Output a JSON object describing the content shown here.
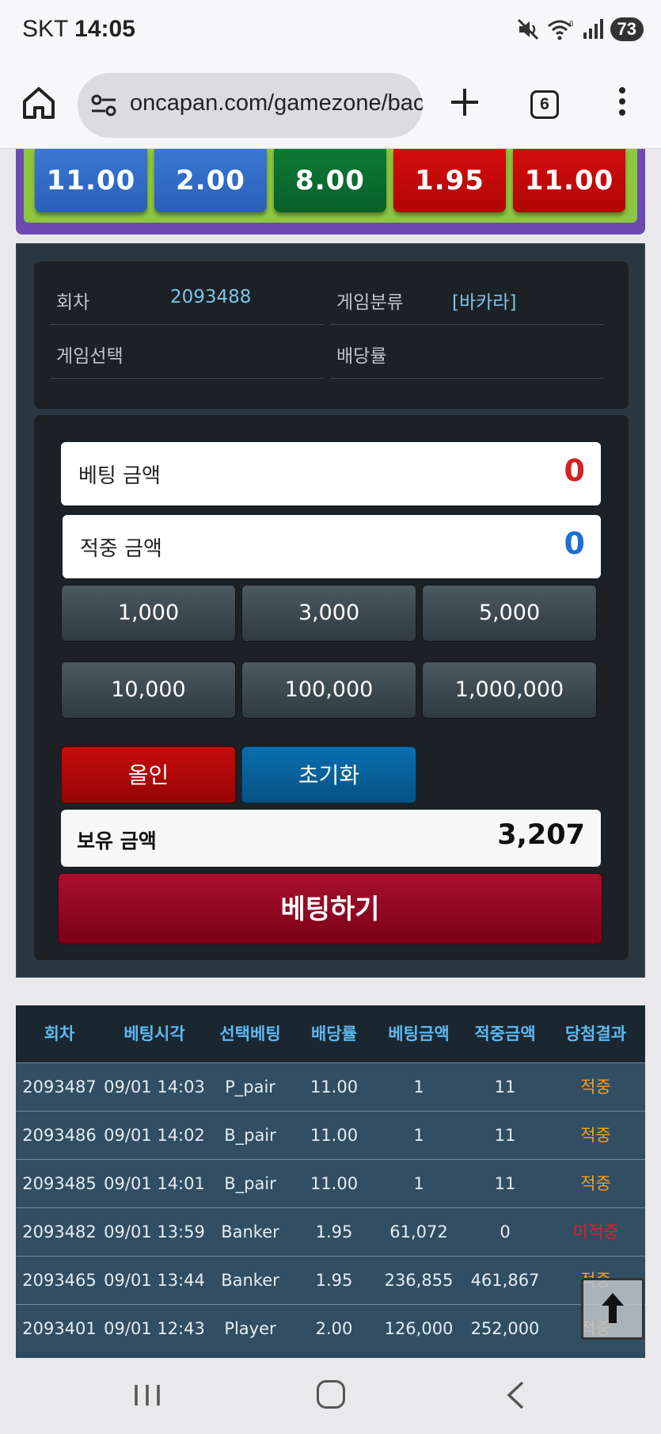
{
  "status_bar": {
    "carrier": "SKT",
    "time": "14:05",
    "battery": "73",
    "wifi_badge": "6"
  },
  "browser": {
    "url": "oncapan.com/gamezone/baccarat",
    "tab_count": "6"
  },
  "odds_buttons": [
    {
      "value": "11.00",
      "color": "#3a78d4"
    },
    {
      "value": "2.00",
      "color": "#3a78d4"
    },
    {
      "value": "8.00",
      "color": "#0d7a34"
    },
    {
      "value": "1.95",
      "color": "#d40d0d"
    },
    {
      "value": "11.00",
      "color": "#d40d0d"
    }
  ],
  "info": {
    "round_label": "회차",
    "round_value": "2093488",
    "category_label": "게임분류",
    "category_value": "[바카라]",
    "selection_label": "게임선택",
    "selection_value": "",
    "odds_label": "배당률",
    "odds_value": ""
  },
  "bet": {
    "bet_amount_label": "베팅 금액",
    "bet_amount_value": "0",
    "win_amount_label": "적중 금액",
    "win_amount_value": "0",
    "chips": [
      "1,000",
      "3,000",
      "5,000",
      "10,000",
      "100,000",
      "1,000,000"
    ],
    "allin_label": "올인",
    "reset_label": "초기화",
    "balance_label": "보유 금액",
    "balance_value": "3,207",
    "submit_label": "베팅하기"
  },
  "history": {
    "columns": [
      "회차",
      "베팅시각",
      "선택베팅",
      "배당률",
      "베팅금액",
      "적중금액",
      "당첨결과"
    ],
    "rows": [
      [
        "2093487",
        "09/01 14:03",
        "P_pair",
        "11.00",
        "1",
        "11",
        "적중"
      ],
      [
        "2093486",
        "09/01 14:02",
        "B_pair",
        "11.00",
        "1",
        "11",
        "적중"
      ],
      [
        "2093485",
        "09/01 14:01",
        "B_pair",
        "11.00",
        "1",
        "11",
        "적중"
      ],
      [
        "2093482",
        "09/01 13:59",
        "Banker",
        "1.95",
        "61,072",
        "0",
        "미적중"
      ],
      [
        "2093465",
        "09/01 13:44",
        "Banker",
        "1.95",
        "236,855",
        "461,867",
        "적중"
      ],
      [
        "2093401",
        "09/01 12:43",
        "Player",
        "2.00",
        "126,000",
        "252,000",
        "적중"
      ]
    ]
  },
  "colors": {
    "win": "#f2a024",
    "lose": "#e0202a",
    "header_text": "#5fb8ef",
    "bet_amount": "#d42020",
    "win_amount": "#1d6fd1"
  }
}
